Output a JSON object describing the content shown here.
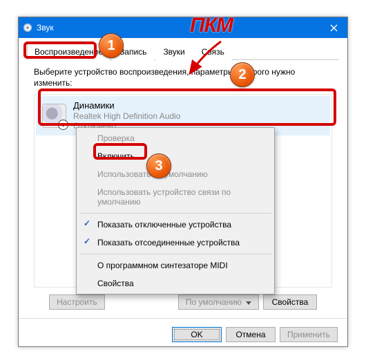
{
  "overlay": {
    "pkm": "ПКМ",
    "badge1": "1",
    "badge2": "2",
    "badge3": "3"
  },
  "window": {
    "title": "Звук"
  },
  "tabs": {
    "playback": "Воспроизведение",
    "recording": "Запись",
    "sounds": "Звуки",
    "communications": "Связь"
  },
  "content": {
    "description": "Выберите устройство воспроизведения, параметры которого нужно изменить:"
  },
  "device": {
    "name": "Динамики",
    "driver": "Realtek High Definition Audio",
    "status": "Отключено",
    "down_symbol": "↓"
  },
  "context_menu": {
    "test": "Проверка",
    "enable": "Включить",
    "set_default": "Использовать по умолчанию",
    "set_default_comm": "Использовать устройство связи по умолчанию",
    "show_disabled": "Показать отключенные устройства",
    "show_disconnected": "Показать отсоединенные устройства",
    "midi_info": "О программном синтезаторе MIDI",
    "properties": "Свойства"
  },
  "buttons": {
    "configure": "Настроить",
    "default": "По умолчанию",
    "properties": "Свойства",
    "ok": "OK",
    "cancel": "Отмена",
    "apply": "Применить"
  }
}
